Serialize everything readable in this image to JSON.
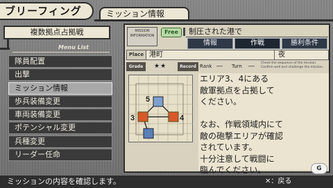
{
  "header": {
    "title": "ブリーフィング",
    "subtitle": "ミッション情報"
  },
  "strategy": {
    "label": "複数拠点占拠戦"
  },
  "menu": {
    "list_label": "Menu List",
    "items": [
      {
        "label": "隊員配置",
        "selected": false
      },
      {
        "label": "出撃",
        "selected": false
      },
      {
        "label": "ミッション情報",
        "selected": true
      },
      {
        "label": "歩兵装備変更",
        "selected": false
      },
      {
        "label": "車両装備変更",
        "selected": false
      },
      {
        "label": "ポテンシャル変更",
        "selected": false
      },
      {
        "label": "兵種変更",
        "selected": false
      },
      {
        "label": "リーダー任命",
        "selected": false
      }
    ]
  },
  "mission": {
    "badge_text": "MISSION INFORMATION",
    "free_label": "Free",
    "title": "制圧された港で",
    "tabs": [
      "情報",
      "作戦",
      "勝利条件"
    ],
    "active_tab": 1,
    "place_label": "Place",
    "place": "港町",
    "time": "夜",
    "grade_label": "Grade",
    "grade_stars": "★★",
    "record_label": "Record",
    "rank_label": "Rank",
    "rank_value": "―",
    "turn_label": "Turn",
    "turn_value": "―",
    "tip": "Check the sequence of the mission. Confirm well and challenge the mission.",
    "map_nodes": [
      "5",
      "3",
      "4"
    ],
    "briefing_lines": [
      "エリア3、4にある",
      "敵軍拠点を占拠して",
      "ください。",
      "",
      "なお、作戦領域内にて",
      "敵の砲撃エリアが確認",
      "されています。",
      "十分注意して戦闘に",
      "臨んでください。"
    ]
  },
  "footer": {
    "help": "ミッションの内容を確認します。",
    "back": "✕：戻る"
  },
  "logo": {
    "text": "G"
  },
  "colors": {
    "enemy_base": "#d8582a",
    "ally_base": "#5a7fb8",
    "tab_bg": "#2e3846"
  }
}
